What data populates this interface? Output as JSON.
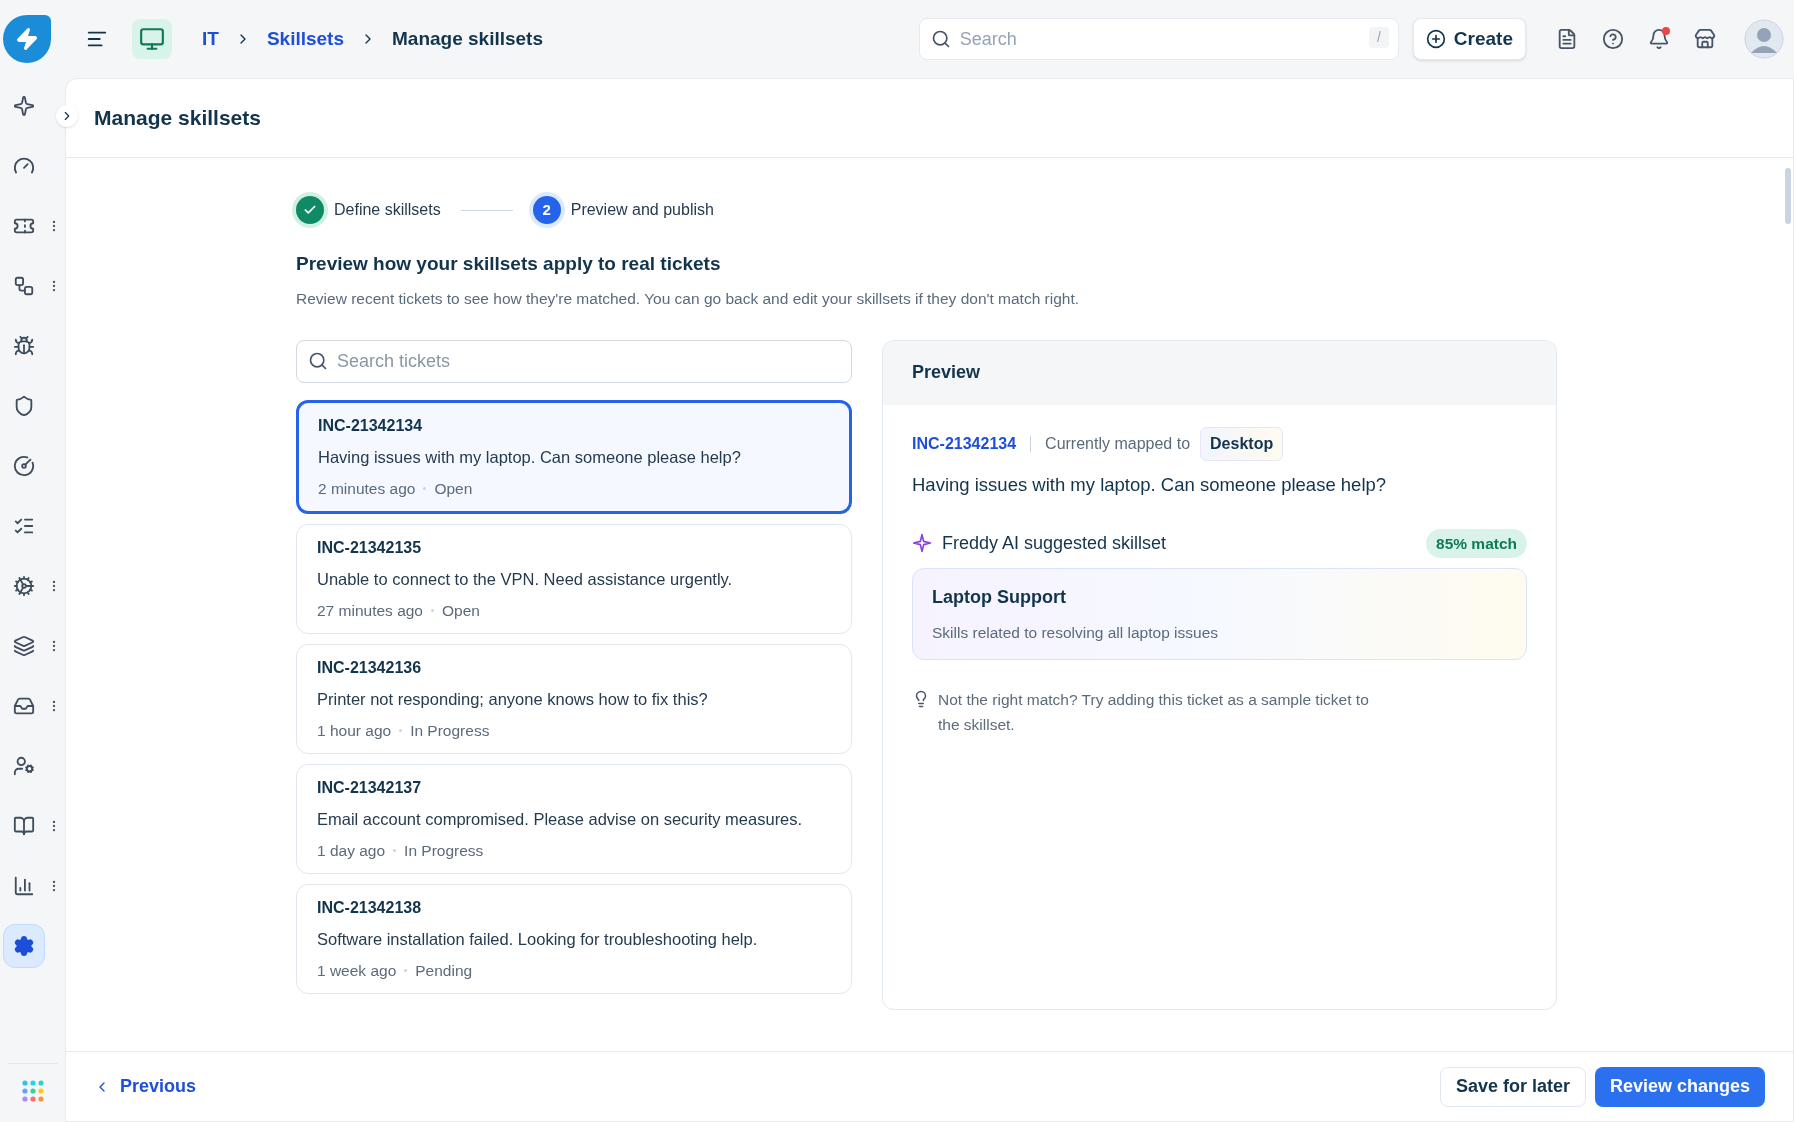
{
  "breadcrumb": [
    {
      "label": "IT",
      "link": true
    },
    {
      "label": "Skillsets",
      "link": true
    },
    {
      "label": "Manage skillsets",
      "link": false
    }
  ],
  "search": {
    "placeholder": "Search",
    "shortcut": "/"
  },
  "create_button": "Create",
  "notifications": {
    "unread": true
  },
  "sidebar": {
    "items": [
      {
        "has_menu": false,
        "selected": false
      },
      {
        "has_menu": false,
        "selected": false
      },
      {
        "has_menu": true,
        "selected": false
      },
      {
        "has_menu": true,
        "selected": false
      },
      {
        "has_menu": false,
        "selected": false
      },
      {
        "has_menu": false,
        "selected": false
      },
      {
        "has_menu": false,
        "selected": false
      },
      {
        "has_menu": false,
        "selected": false
      },
      {
        "has_menu": true,
        "selected": false
      },
      {
        "has_menu": true,
        "selected": false
      },
      {
        "has_menu": true,
        "selected": false
      },
      {
        "has_menu": false,
        "selected": false
      },
      {
        "has_menu": true,
        "selected": false
      },
      {
        "has_menu": true,
        "selected": false
      },
      {
        "has_menu": false,
        "selected": true
      }
    ]
  },
  "page_title": "Manage skillsets",
  "steps": [
    {
      "label": "Define skillsets",
      "done": true,
      "selected": false
    },
    {
      "label": "Preview and publish",
      "done": false,
      "selected": true,
      "number": "2"
    }
  ],
  "section": {
    "title": "Preview how your skillsets apply to real tickets",
    "description": "Review recent tickets to see how they're matched. You can go back and edit your skillsets if they don't match right."
  },
  "ticket_search": {
    "placeholder": "Search tickets"
  },
  "tickets": [
    {
      "id": "INC-21342134",
      "summary": "Having issues with my laptop. Can someone please help?",
      "time": "2 minutes ago",
      "status": "Open",
      "selected": true
    },
    {
      "id": "INC-21342135",
      "summary": "Unable to connect to the VPN. Need assistance urgently.",
      "time": "27 minutes ago",
      "status": "Open",
      "selected": false
    },
    {
      "id": "INC-21342136",
      "summary": "Printer not responding; anyone knows how to fix this?",
      "time": "1 hour ago",
      "status": "In Progress",
      "selected": false
    },
    {
      "id": "INC-21342137",
      "summary": "Email account compromised. Please advise on security measures.",
      "time": "1 day ago",
      "status": "In Progress",
      "selected": false
    },
    {
      "id": "INC-21342138",
      "summary": "Software installation failed. Looking for troubleshooting help.",
      "time": "1 week ago",
      "status": "Pending",
      "selected": false
    }
  ],
  "preview": {
    "title": "Preview",
    "ticket_id": "INC-21342134",
    "mapped_label": "Currently mapped to",
    "mapped_to": "Desktop",
    "summary": "Having issues with my laptop. Can someone please help?",
    "suggestion_label": "Freddy AI suggested skillset",
    "match": "85% match",
    "skillset_name": "Laptop Support",
    "skillset_description": "Skills related to resolving all laptop issues",
    "hint": "Not the right match? Try adding this ticket as a sample ticket to the skillset."
  },
  "footer": {
    "previous": "Previous",
    "save": "Save for later",
    "review": "Review changes"
  }
}
